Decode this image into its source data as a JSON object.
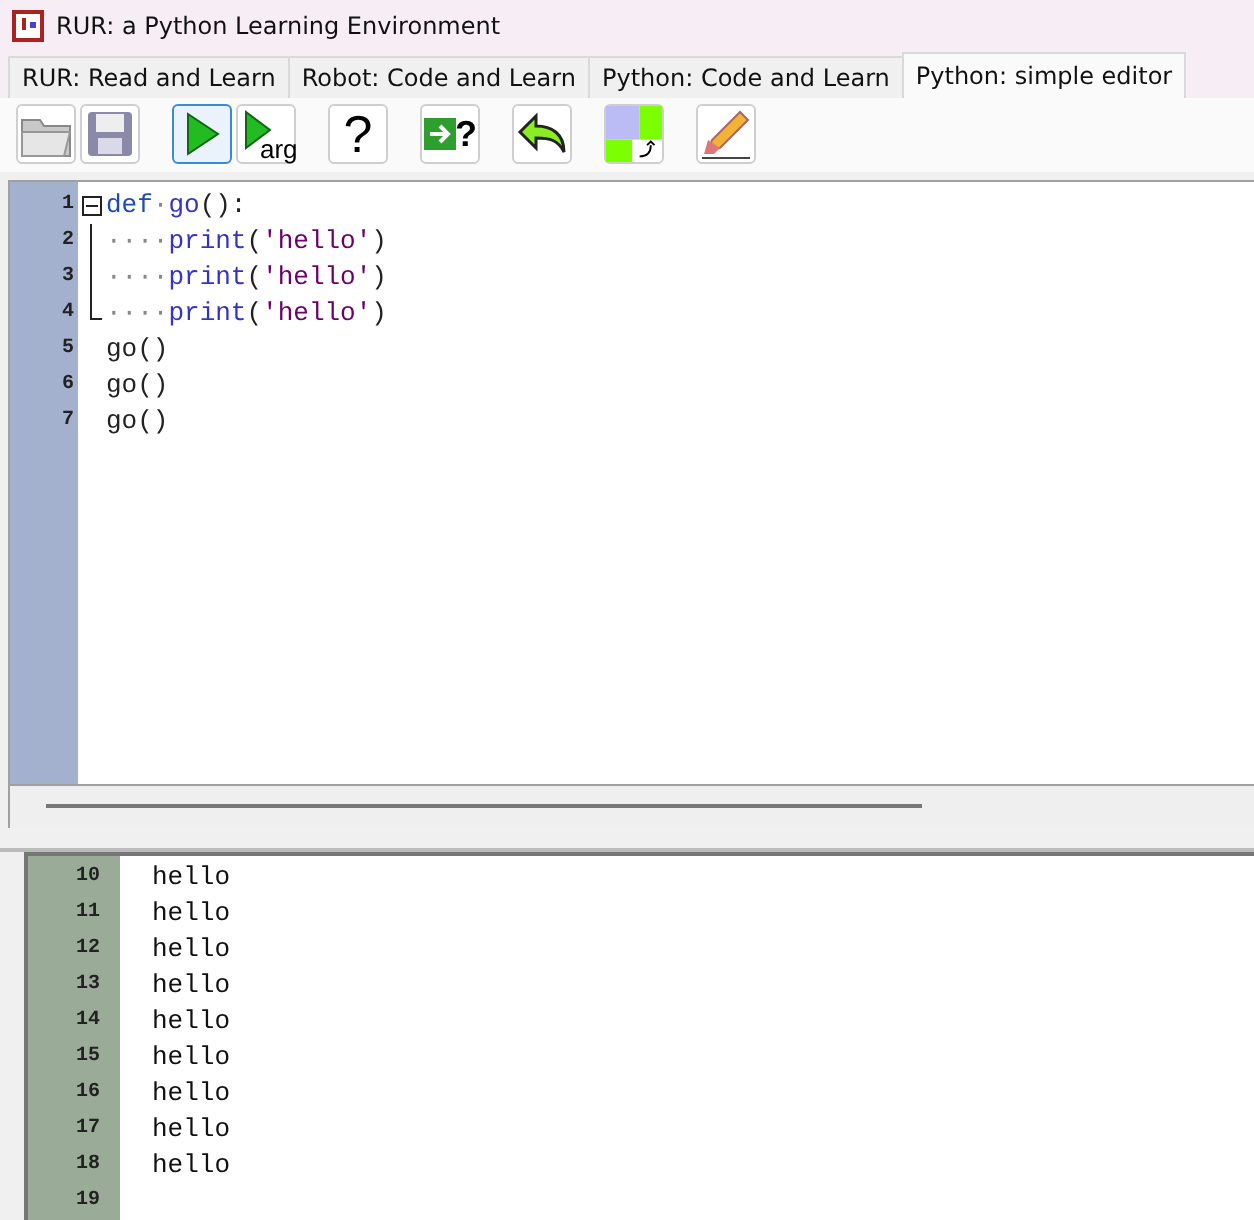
{
  "window": {
    "title": "RUR: a Python Learning Environment"
  },
  "tabs": [
    {
      "label": "RUR: Read and Learn",
      "selected": false
    },
    {
      "label": "Robot: Code and Learn",
      "selected": false
    },
    {
      "label": "Python: Code and Learn",
      "selected": false
    },
    {
      "label": "Python: simple editor",
      "selected": true
    }
  ],
  "toolbar": [
    {
      "kind": "open",
      "selected": false
    },
    {
      "kind": "save",
      "selected": false
    },
    {
      "kind": "run",
      "selected": true
    },
    {
      "kind": "run_arg",
      "label": "arg",
      "selected": false
    },
    {
      "kind": "help",
      "label": "?",
      "selected": false
    },
    {
      "kind": "input_help",
      "label": "?",
      "selected": false
    },
    {
      "kind": "undo",
      "selected": false
    },
    {
      "kind": "swap",
      "selected": false
    },
    {
      "kind": "clear",
      "selected": false
    }
  ],
  "editor": {
    "lines": [
      {
        "number": "1",
        "kind": "foldstart",
        "tokens": [
          {
            "kind": "keyword",
            "text": "def"
          },
          {
            "kind": "space",
            "text": "·"
          },
          {
            "kind": "name",
            "text": "go"
          },
          {
            "kind": "plain",
            "text": "():"
          }
        ]
      },
      {
        "number": "2",
        "kind": "foldbody",
        "indent": "····",
        "tokens": [
          {
            "kind": "name",
            "text": "print"
          },
          {
            "kind": "plain",
            "text": "("
          },
          {
            "kind": "string",
            "text": "'hello'"
          },
          {
            "kind": "plain",
            "text": ")"
          }
        ]
      },
      {
        "number": "3",
        "kind": "foldbody",
        "indent": "····",
        "tokens": [
          {
            "kind": "name",
            "text": "print"
          },
          {
            "kind": "plain",
            "text": "("
          },
          {
            "kind": "string",
            "text": "'hello'"
          },
          {
            "kind": "plain",
            "text": ")"
          }
        ]
      },
      {
        "number": "4",
        "kind": "foldend",
        "indent": "····",
        "tokens": [
          {
            "kind": "name",
            "text": "print"
          },
          {
            "kind": "plain",
            "text": "("
          },
          {
            "kind": "string",
            "text": "'hello'"
          },
          {
            "kind": "plain",
            "text": ")"
          }
        ]
      },
      {
        "number": "5",
        "kind": "plain",
        "tokens": [
          {
            "kind": "plain",
            "text": "go()"
          }
        ]
      },
      {
        "number": "6",
        "kind": "plain",
        "tokens": [
          {
            "kind": "plain",
            "text": "go()"
          }
        ]
      },
      {
        "number": "7",
        "kind": "plain",
        "tokens": [
          {
            "kind": "plain",
            "text": "go()"
          }
        ]
      }
    ]
  },
  "output": {
    "lines": [
      {
        "number": "10",
        "text": "hello"
      },
      {
        "number": "11",
        "text": "hello"
      },
      {
        "number": "12",
        "text": "hello"
      },
      {
        "number": "13",
        "text": "hello"
      },
      {
        "number": "14",
        "text": "hello"
      },
      {
        "number": "15",
        "text": "hello"
      },
      {
        "number": "16",
        "text": "hello"
      },
      {
        "number": "17",
        "text": "hello"
      },
      {
        "number": "18",
        "text": "hello"
      },
      {
        "number": "19"
      }
    ]
  }
}
